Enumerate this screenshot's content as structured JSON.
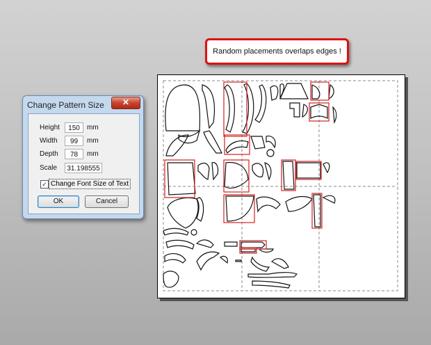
{
  "callout": {
    "text": "Random placements overlaps edges !"
  },
  "dialog": {
    "title": "Change Pattern Size",
    "close_glyph": "✕",
    "fields": {
      "height": {
        "label": "Height",
        "value": "150",
        "unit": "mm"
      },
      "width": {
        "label": "Width",
        "value": "99",
        "unit": "mm"
      },
      "depth": {
        "label": "Depth",
        "value": "78",
        "unit": "mm"
      },
      "scale": {
        "label": "Scale",
        "value": "31.198555"
      }
    },
    "change_font": {
      "label": "Change Font Size of Text",
      "checked": true,
      "check_glyph": "✓"
    },
    "buttons": {
      "ok": "OK",
      "cancel": "Cancel"
    }
  },
  "canvas": {
    "grid": "2 x 2 dashed sheets",
    "highlight_color": "#d42020"
  }
}
